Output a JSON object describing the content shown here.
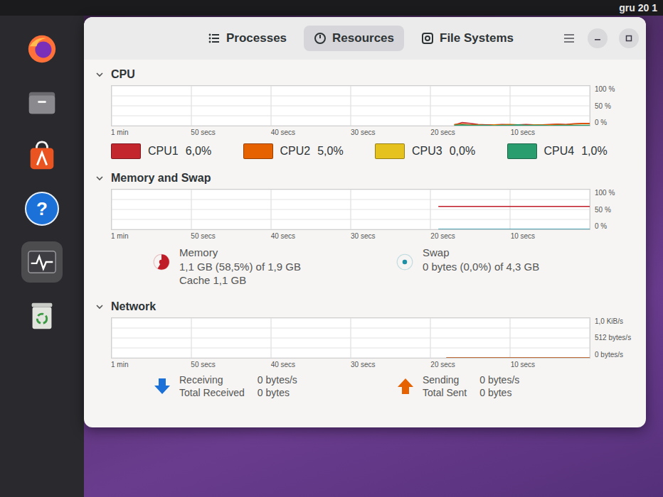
{
  "top_bar": {
    "clock": "gru 20 1"
  },
  "dock": [
    {
      "kind": "firefox",
      "selected": false
    },
    {
      "kind": "files",
      "selected": false
    },
    {
      "kind": "app-center",
      "selected": false
    },
    {
      "kind": "help",
      "selected": false,
      "glyph": "?"
    },
    {
      "kind": "monitor",
      "selected": true
    },
    {
      "kind": "trash",
      "selected": false
    }
  ],
  "tabs": [
    {
      "label": "Processes",
      "selected": false,
      "kind": "list"
    },
    {
      "label": "Resources",
      "selected": true,
      "kind": "gauge"
    },
    {
      "label": "File Systems",
      "selected": false,
      "kind": "disk"
    }
  ],
  "cpu": {
    "title": "CPU",
    "expanded": true,
    "chart": {
      "x_ticks": [
        "1 min",
        "50 secs",
        "40 secs",
        "30 secs",
        "20 secs",
        "10 secs"
      ],
      "y_ticks": [
        "100 %",
        "50 %",
        "0 %"
      ]
    },
    "series": [
      {
        "label": "CPU1",
        "value": "6,0%",
        "color": "#c4262e",
        "values": [
          2,
          8,
          6,
          3,
          2,
          2,
          3,
          2,
          2,
          3,
          2,
          2,
          3,
          4,
          3,
          5,
          6,
          6
        ]
      },
      {
        "label": "CPU2",
        "value": "5,0%",
        "color": "#e66100",
        "values": [
          3,
          4,
          2,
          2,
          1,
          2,
          2,
          3,
          2,
          1,
          2,
          2,
          2,
          3,
          2,
          4,
          5,
          5
        ]
      },
      {
        "label": "CPU3",
        "value": "0,0%",
        "color": "#e5c21d",
        "values": [
          0,
          1,
          0,
          0,
          0,
          1,
          0,
          0,
          0,
          0,
          1,
          0,
          0,
          0,
          0,
          0,
          0,
          0
        ]
      },
      {
        "label": "CPU4",
        "value": "1,0%",
        "color": "#2a9d6f",
        "values": [
          1,
          2,
          1,
          1,
          1,
          0,
          1,
          1,
          2,
          1,
          1,
          1,
          0,
          1,
          1,
          1,
          1,
          1
        ]
      }
    ]
  },
  "memory": {
    "title": "Memory and Swap",
    "expanded": true,
    "chart": {
      "x_ticks": [
        "1 min",
        "50 secs",
        "40 secs",
        "30 secs",
        "20 secs",
        "10 secs"
      ],
      "y_ticks": [
        "100 %",
        "50 %",
        "0 %"
      ]
    },
    "series": [
      {
        "label": "Memory",
        "detail": "1,1 GB (58,5%) of 1,9 GB",
        "extra": "Cache 1,1 GB",
        "level": 0.585,
        "color": "#c01c28",
        "values": [
          58.5,
          58.5,
          58.5,
          58.5,
          58.5,
          58.5,
          58.5,
          58.5,
          58.5,
          58.5,
          58.5,
          58.5,
          58.5,
          58.5,
          58.5,
          58.5,
          58.5,
          58.5,
          58.5,
          58.5
        ]
      },
      {
        "label": "Swap",
        "detail": "0 bytes (0,0%) of 4,3 GB",
        "extra": "",
        "level": 0,
        "color": "#2190a4",
        "values": [
          0,
          0,
          0,
          0,
          0,
          0,
          0,
          0,
          0,
          0,
          0,
          0,
          0,
          0,
          0,
          0,
          0,
          0,
          0,
          0
        ]
      }
    ]
  },
  "network": {
    "title": "Network",
    "expanded": true,
    "chart": {
      "x_ticks": [
        "1 min",
        "50 secs",
        "40 secs",
        "30 secs",
        "20 secs",
        "10 secs"
      ],
      "y_ticks": [
        "1,0 KiB/s",
        "512 bytes/s",
        "0 bytes/s"
      ]
    },
    "series": [
      {
        "label": "Receiving",
        "rate": "0 bytes/s",
        "total_label": "Total Received",
        "total": "0 bytes",
        "color": "#1c71d8",
        "direction": "down",
        "values": [
          0,
          0,
          0,
          0,
          0,
          0,
          0,
          0,
          0,
          0,
          0,
          0,
          0,
          0,
          0,
          0,
          0,
          0,
          0
        ]
      },
      {
        "label": "Sending",
        "rate": "0 bytes/s",
        "total_label": "Total Sent",
        "total": "0 bytes",
        "color": "#e66100",
        "direction": "up",
        "values": [
          0,
          0,
          0,
          0,
          0,
          0,
          0,
          0,
          0,
          0,
          0,
          0,
          0,
          0,
          0,
          0,
          0,
          0,
          0
        ]
      }
    ]
  }
}
